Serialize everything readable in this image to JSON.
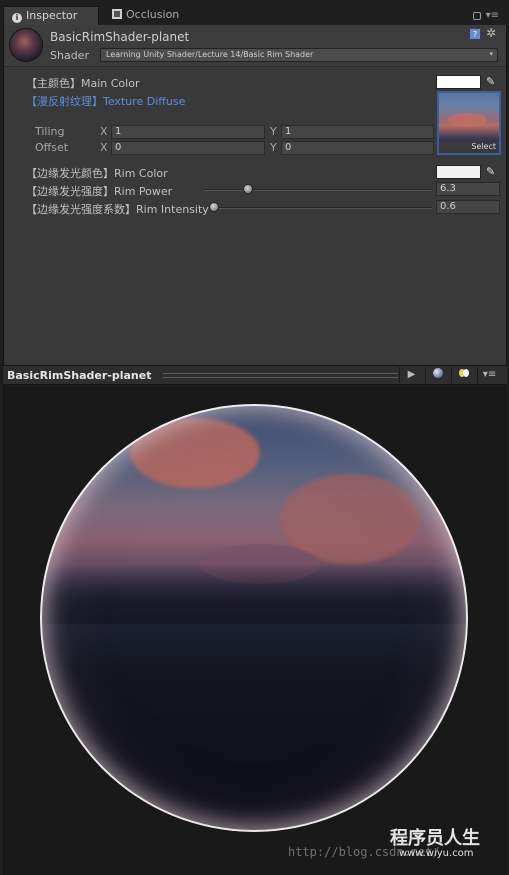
{
  "tabs": [
    {
      "label": "Inspector",
      "icon": "info-icon"
    },
    {
      "label": "Occlusion",
      "icon": "occlusion-icon"
    }
  ],
  "material": {
    "name": "BasicRimShader-planet",
    "shader_label": "Shader",
    "shader_value": "Learning Unity Shader/Lecture 14/Basic Rim Shader"
  },
  "properties": {
    "main_color": {
      "label": "【主颜色】Main Color",
      "color": "#ffffff"
    },
    "texture": {
      "label": "【漫反射纹理】Texture Diffuse",
      "select": "Select",
      "tiling_label": "Tiling",
      "offset_label": "Offset",
      "tiling_x": "1",
      "tiling_y": "1",
      "offset_x": "0",
      "offset_y": "0",
      "x_label": "X",
      "y_label": "Y"
    },
    "rim_color": {
      "label": "【边缘发光颜色】Rim Color",
      "color": "#f2f2f2"
    },
    "rim_power": {
      "label": "【边缘发光强度】Rim Power",
      "value": "6.3",
      "fraction": 0.18
    },
    "rim_intensity": {
      "label": "【边缘发光强度系数】Rim Intensity",
      "value": "0.6",
      "fraction": 0.0
    }
  },
  "preview": {
    "title": "BasicRimShader-planet"
  },
  "watermark": {
    "url": "http://blog.csdn.net/",
    "cn": "程序员人生",
    "site": "www.wiyu.com"
  },
  "colors": {
    "accent_blue": "#5c8fe0",
    "panel_bg": "#393939"
  }
}
